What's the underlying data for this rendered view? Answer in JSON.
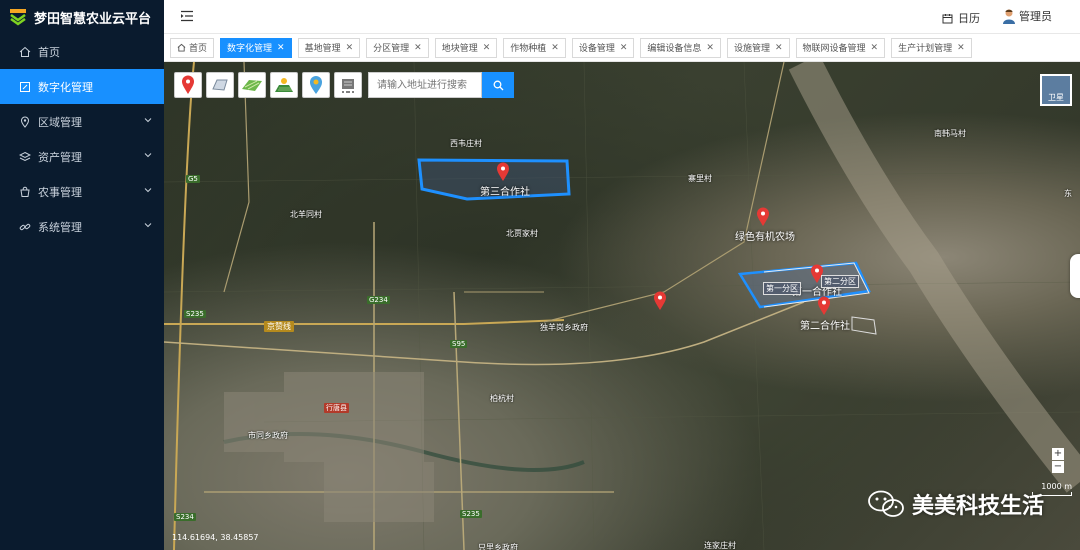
{
  "app": {
    "title": "梦田智慧农业云平台"
  },
  "sidebar": {
    "items": [
      {
        "label": "首页",
        "icon": "home-icon",
        "active": false,
        "expandable": false
      },
      {
        "label": "数字化管理",
        "icon": "edit-icon",
        "active": true,
        "expandable": false
      },
      {
        "label": "区域管理",
        "icon": "location-icon",
        "active": false,
        "expandable": true
      },
      {
        "label": "资产管理",
        "icon": "layers-icon",
        "active": false,
        "expandable": true
      },
      {
        "label": "农事管理",
        "icon": "bag-icon",
        "active": false,
        "expandable": true
      },
      {
        "label": "系统管理",
        "icon": "link-icon",
        "active": false,
        "expandable": true
      }
    ]
  },
  "header": {
    "calendar_label": "日历",
    "user_label": "管理员"
  },
  "tabs": [
    {
      "label": "首页",
      "closable": false,
      "active": false
    },
    {
      "label": "数字化管理",
      "closable": true,
      "active": true
    },
    {
      "label": "基地管理",
      "closable": true,
      "active": false
    },
    {
      "label": "分区管理",
      "closable": true,
      "active": false
    },
    {
      "label": "地块管理",
      "closable": true,
      "active": false
    },
    {
      "label": "作物种植",
      "closable": true,
      "active": false
    },
    {
      "label": "设备管理",
      "closable": true,
      "active": false
    },
    {
      "label": "编辑设备信息",
      "closable": true,
      "active": false
    },
    {
      "label": "设施管理",
      "closable": true,
      "active": false
    },
    {
      "label": "物联网设备管理",
      "closable": true,
      "active": false
    },
    {
      "label": "生产计划管理",
      "closable": true,
      "active": false
    }
  ],
  "map": {
    "search_placeholder": "请输入地址进行搜索",
    "layer_label": "卫星",
    "zoom_in": "+",
    "zoom_out": "−",
    "scale_text": "1000 m",
    "coordinates": "114.61694, 38.45857",
    "place_names": [
      "西韦庄村",
      "北羊同村",
      "北贾家村",
      "寨里村",
      "南韩马村",
      "独羊岗乡政府",
      "柏杭村",
      "市同乡政府",
      "连家庄村",
      "只里乡政府",
      "东"
    ],
    "road_labels": [
      "G5",
      "G234",
      "S235",
      "S95",
      "京赞线",
      "行唐县",
      "S234",
      "S235"
    ],
    "coops": [
      "第三合作社",
      "绿色有机农场",
      "第一合作社",
      "第二合作社"
    ],
    "zones": [
      "第一分区",
      "第二分区"
    ]
  },
  "watermark": {
    "text": "美美科技生活"
  },
  "colors": {
    "accent": "#1890ff",
    "sidebar_bg": "#0a1b2e",
    "pin": "#e53935"
  }
}
